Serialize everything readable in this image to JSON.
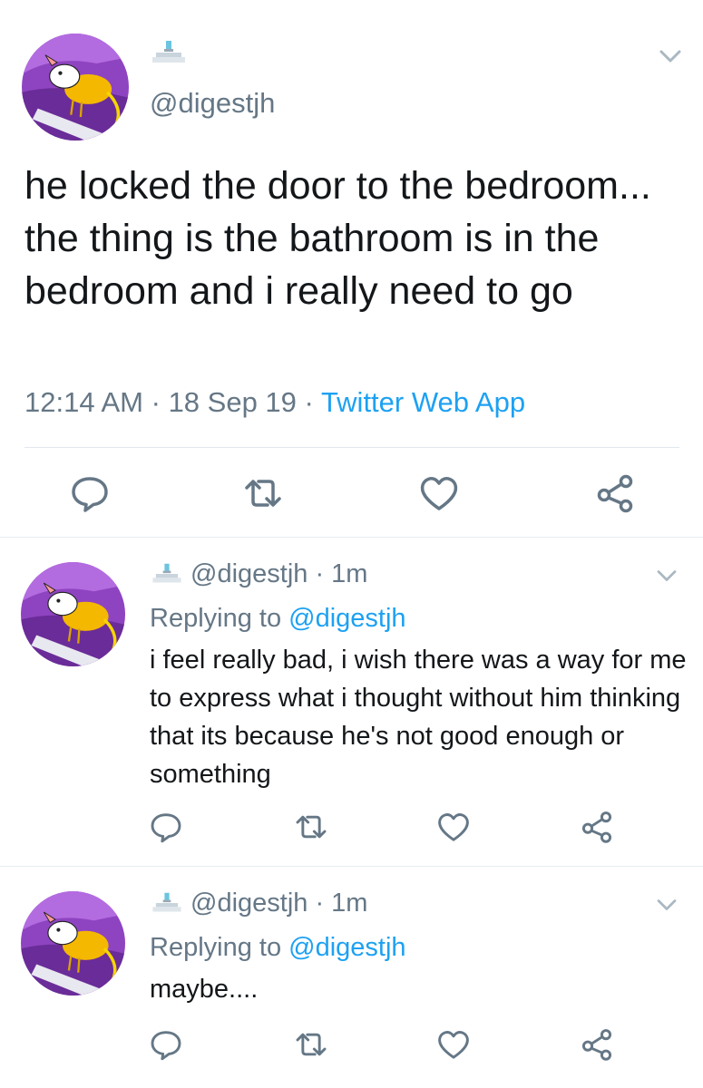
{
  "main_tweet": {
    "handle": "@digestjh",
    "text": "he locked the door to the bedroom... the thing is the bathroom is in the bedroom and i really need to go",
    "time": "12:14 AM",
    "date": "18 Sep 19",
    "dot": "·",
    "app": "Twitter Web App"
  },
  "replies": [
    {
      "handle_line": "@digestjh · 1m",
      "replying_label": "Replying to",
      "replying_handle": "@digestjh",
      "text": "i feel really bad, i wish there was a way for me to express what i thought without him thinking that its because he's not good enough or something"
    },
    {
      "handle_line": "@digestjh · 1m",
      "replying_label": "Replying to",
      "replying_handle": "@digestjh",
      "text": "maybe...."
    }
  ],
  "icons": {
    "reply": "reply-icon",
    "retweet": "retweet-icon",
    "like": "heart-icon",
    "share": "share-icon",
    "menu": "chevron-down-icon",
    "badge": "fountain-icon"
  },
  "colors": {
    "text": "#14171a",
    "secondary": "#657786",
    "link": "#1da1f2",
    "avatar_bg": "#9b59c8",
    "avatar_char": "#f5b800"
  }
}
